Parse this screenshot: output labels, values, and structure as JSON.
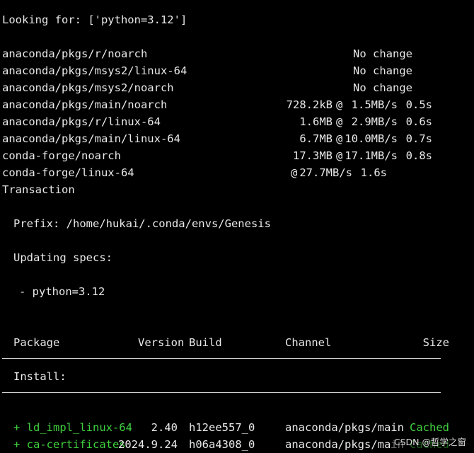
{
  "terminal": {
    "looking_for": "Looking for: ['python=3.12']",
    "repos": [
      {
        "name": "anaconda/pkgs/r/noarch",
        "size": "",
        "at": "",
        "speed": "",
        "time": "",
        "status": "No change"
      },
      {
        "name": "anaconda/pkgs/msys2/linux-64",
        "size": "",
        "at": "",
        "speed": "",
        "time": "",
        "status": "No change"
      },
      {
        "name": "anaconda/pkgs/msys2/noarch",
        "size": "",
        "at": "",
        "speed": "",
        "time": "",
        "status": "No change"
      },
      {
        "name": "anaconda/pkgs/main/noarch",
        "size": "728.2kB",
        "at": "@",
        "speed": "1.5MB/s",
        "time": "0.5s",
        "status": ""
      },
      {
        "name": "anaconda/pkgs/r/linux-64",
        "size": "1.6MB",
        "at": "@",
        "speed": "2.9MB/s",
        "time": "0.6s",
        "status": ""
      },
      {
        "name": "anaconda/pkgs/main/linux-64",
        "size": "6.7MB",
        "at": "@",
        "speed": "10.0MB/s",
        "time": "0.7s",
        "status": ""
      },
      {
        "name": "conda-forge/noarch",
        "size": "17.3MB",
        "at": "@",
        "speed": "17.1MB/s",
        "time": "0.8s",
        "status": ""
      },
      {
        "name": "conda-forge/linux-64",
        "size": "",
        "at": "@",
        "speed": "27.7MB/s",
        "time": "1.6s",
        "status": ""
      }
    ],
    "transaction": "Transaction",
    "prefix": "Prefix: /home/hukai/.conda/envs/Genesis",
    "updating_specs": "Updating specs:",
    "spec_item": "- python=3.12",
    "table_headers": {
      "package": "Package",
      "version": "Version",
      "build": "Build",
      "channel": "Channel",
      "size": "Size"
    },
    "install_label": "Install:",
    "packages": [
      {
        "name": "+ ld_impl_linux-64",
        "version": "2.40",
        "build": "h12ee557_0",
        "channel": "anaconda/pkgs/main",
        "size": "Cached"
      },
      {
        "name": "+ ca-certificates",
        "version": "2024.9.24",
        "build": "h06a4308_0",
        "channel": "anaconda/pkgs/main",
        "size": "Cached"
      }
    ],
    "colors": {
      "background": "#000000",
      "text": "#e9e9e9",
      "installed": "#3fd13f"
    }
  },
  "watermark": "CSDN @哲学之窗"
}
